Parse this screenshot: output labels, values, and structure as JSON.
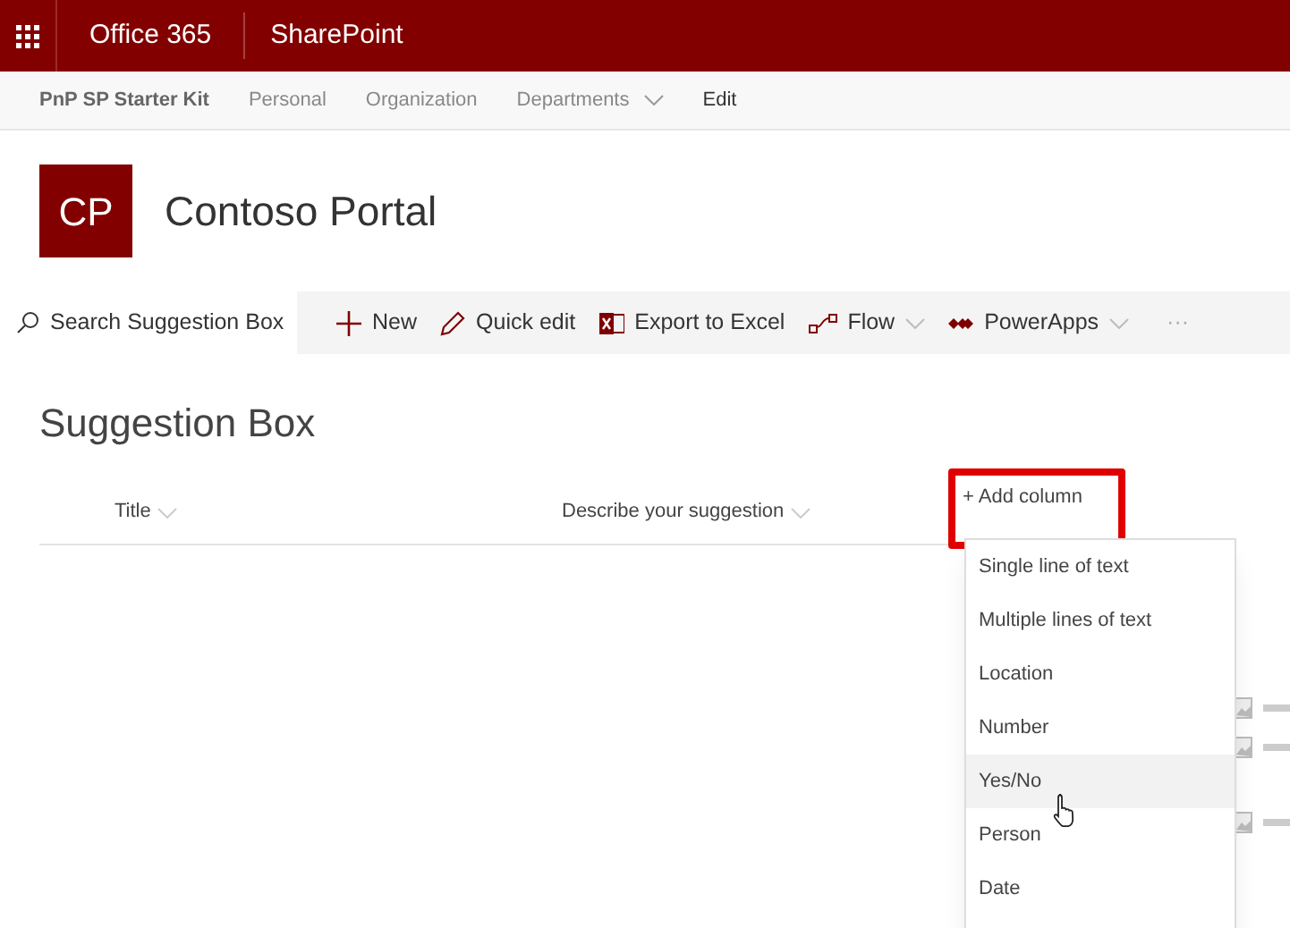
{
  "suite_bar": {
    "brand": "Office 365",
    "app": "SharePoint"
  },
  "site_nav": {
    "site_name": "PnP SP Starter Kit",
    "links": [
      {
        "label": "Personal",
        "dropdown": false
      },
      {
        "label": "Organization",
        "dropdown": false
      },
      {
        "label": "Departments",
        "dropdown": true
      },
      {
        "label": "Edit",
        "dropdown": false
      }
    ]
  },
  "site_header": {
    "logo": "CP",
    "title": "Contoso Portal"
  },
  "command_bar": {
    "search": {
      "placeholder": "Search Suggestion Box"
    },
    "commands": [
      {
        "kind": "new",
        "label": "New",
        "dropdown": false
      },
      {
        "kind": "edit",
        "label": "Quick edit",
        "dropdown": false
      },
      {
        "kind": "excel",
        "label": "Export to Excel",
        "dropdown": false
      },
      {
        "kind": "flow",
        "label": "Flow",
        "dropdown": true
      },
      {
        "kind": "powerapps",
        "label": "PowerApps",
        "dropdown": true
      },
      {
        "kind": "more",
        "label": "···",
        "dropdown": false
      }
    ]
  },
  "list": {
    "title": "Suggestion Box",
    "columns": [
      "Title",
      "Describe your suggestion"
    ],
    "add_column": "+ Add column"
  },
  "add_column_menu": [
    {
      "label": "Single line of text",
      "selected": false
    },
    {
      "label": "Multiple lines of text",
      "selected": false
    },
    {
      "label": "Location",
      "selected": false
    },
    {
      "label": "Number",
      "selected": false
    },
    {
      "label": "Yes/No",
      "selected": true
    },
    {
      "label": "Person",
      "selected": false
    },
    {
      "label": "Date",
      "selected": false
    }
  ]
}
